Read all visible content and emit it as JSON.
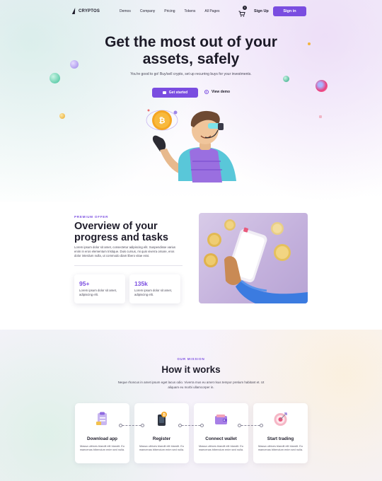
{
  "nav": {
    "logo": "CRYPTOS",
    "menu": [
      "Demos",
      "Company",
      "Pricing",
      "Tokens",
      "All Pages"
    ],
    "cart_count": "0",
    "signup": "Sign Up",
    "signin": "Sign in"
  },
  "hero": {
    "title": "Get the most out of your assets, safely",
    "subtitle": "You're good to go! Buy/sell crypto, set up recurring buys for your investments.",
    "primary_button": "Get started",
    "demo_button": "View demo"
  },
  "overview": {
    "eyebrow": "PREMIUM OFFER",
    "title": "Overview of your progress and tasks",
    "text": "Lorem ipsum dolor sit amet, consectetur adipiscing elit. Suspendisse varius enim in eros elementum tristique. Duis cursus, mi quis viverra ornare, eros dolor interdum nulla, ut commodo diam libero vitae erat.",
    "stats": [
      {
        "value": "95+",
        "desc": "Lorem ipsum dolor sit amet, adipiscing elit."
      },
      {
        "value": "135k",
        "desc": "Lorem ipsum dolor sit amet, adipiscing elit."
      }
    ]
  },
  "how": {
    "eyebrow": "OUR MISSION",
    "title": "How it works",
    "subtitle": "Neque rhoncus in amet ipsum eget lacus odio. Viverra mus eu amet risus tempor pretium habitant et. Ut aliquam eu morbi ullamcorper in.",
    "steps": [
      {
        "title": "Download app",
        "desc": "Massa ultrices blandit elit blandit. Eu maecenas bibendum enim sed nulla."
      },
      {
        "title": "Register",
        "desc": "Massa ultrices blandit elit blandit. Eu maecenas bibendum enim sed nulla."
      },
      {
        "title": "Connect wallet",
        "desc": "Massa ultrices blandit elit blandit. Eu maecenas bibendum enim sed nulla."
      },
      {
        "title": "Start trading",
        "desc": "Massa ultrices blandit elit blandit. Eu maecenas bibendum enim sed nulla."
      }
    ]
  },
  "colors": {
    "accent": "#7a4de0",
    "text": "#1f1d2b"
  },
  "icons": {
    "logo": "lightning-logo-icon",
    "cart": "cart-icon",
    "get_started": "card-icon",
    "demo": "play-circle-icon",
    "steps": [
      "clipboard-icon",
      "phone-bitcoin-icon",
      "wallet-icon",
      "target-icon"
    ]
  }
}
